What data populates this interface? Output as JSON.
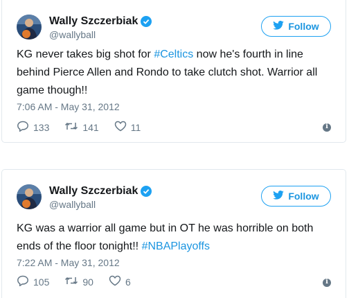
{
  "tweets": [
    {
      "author": {
        "name": "Wally Szczerbiak",
        "handle": "@wallyball",
        "verified_icon": "verified-badge-icon"
      },
      "follow_label": "Follow",
      "text_before": "KG never takes big shot for ",
      "hashtag": "#Celtics",
      "text_after": " now he's fourth in line behind Pierce Allen and Rondo to take clutch shot. Warrior all game though!!",
      "timestamp": "7:06 AM - May 31, 2012",
      "replies": "133",
      "retweets": "141",
      "likes": "11"
    },
    {
      "author": {
        "name": "Wally Szczerbiak",
        "handle": "@wallyball",
        "verified_icon": "verified-badge-icon"
      },
      "follow_label": "Follow",
      "text_before": "KG was a warrior all game but in OT he was horrible on both ends of the floor tonight!! ",
      "hashtag": "#NBAPlayoffs",
      "text_after": "",
      "timestamp": "7:22 AM - May 31, 2012",
      "replies": "105",
      "retweets": "90",
      "likes": "6"
    }
  ],
  "colors": {
    "accent": "#1da1f2",
    "link": "#1b95e0",
    "muted": "#657786",
    "text": "#14171a",
    "border": "#e1e8ed"
  }
}
